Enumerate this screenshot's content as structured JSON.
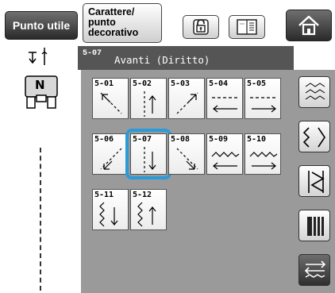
{
  "topbar": {
    "utility_stitch_label": "Punto utile",
    "decorative_label_line1": "Carattere/",
    "decorative_label_line2": "punto",
    "decorative_label_line3": "decorativo",
    "lock_icon": "lock-icon",
    "book_icon": "manual-icon",
    "home_icon": "home-icon"
  },
  "presser": {
    "foot_letter": "N"
  },
  "header": {
    "code": "5-07",
    "title": "Avanti (Diritto)"
  },
  "stitches": [
    {
      "id": "5-01",
      "label": "5-01",
      "arrow": "up-left"
    },
    {
      "id": "5-02",
      "label": "5-02",
      "arrow": "up"
    },
    {
      "id": "5-03",
      "label": "5-03",
      "arrow": "up-right"
    },
    {
      "id": "5-04",
      "label": "5-04",
      "arrow": "left"
    },
    {
      "id": "5-05",
      "label": "5-05",
      "arrow": "right"
    },
    {
      "id": "5-06",
      "label": "5-06",
      "arrow": "down-left"
    },
    {
      "id": "5-07",
      "label": "5-07",
      "arrow": "down",
      "selected": true
    },
    {
      "id": "5-08",
      "label": "5-08",
      "arrow": "down-right"
    },
    {
      "id": "5-09",
      "label": "5-09",
      "arrow": "zigzag-left"
    },
    {
      "id": "5-10",
      "label": "5-10",
      "arrow": "zigzag-right"
    },
    {
      "id": "5-11",
      "label": "5-11",
      "arrow": "zigzag-down"
    },
    {
      "id": "5-12",
      "label": "5-12",
      "arrow": "zigzag-up"
    }
  ],
  "sidebar": {
    "buttons": [
      "category-stitch-icon",
      "direction-stitch-icon",
      "satin-stitch-icon",
      "cross-stitch-icon",
      "multi-direction-icon"
    ],
    "active_index": 4
  },
  "colors": {
    "selection": "#2a9bd8",
    "header_bg": "#555555",
    "panel_bg": "#9a9a9a"
  }
}
